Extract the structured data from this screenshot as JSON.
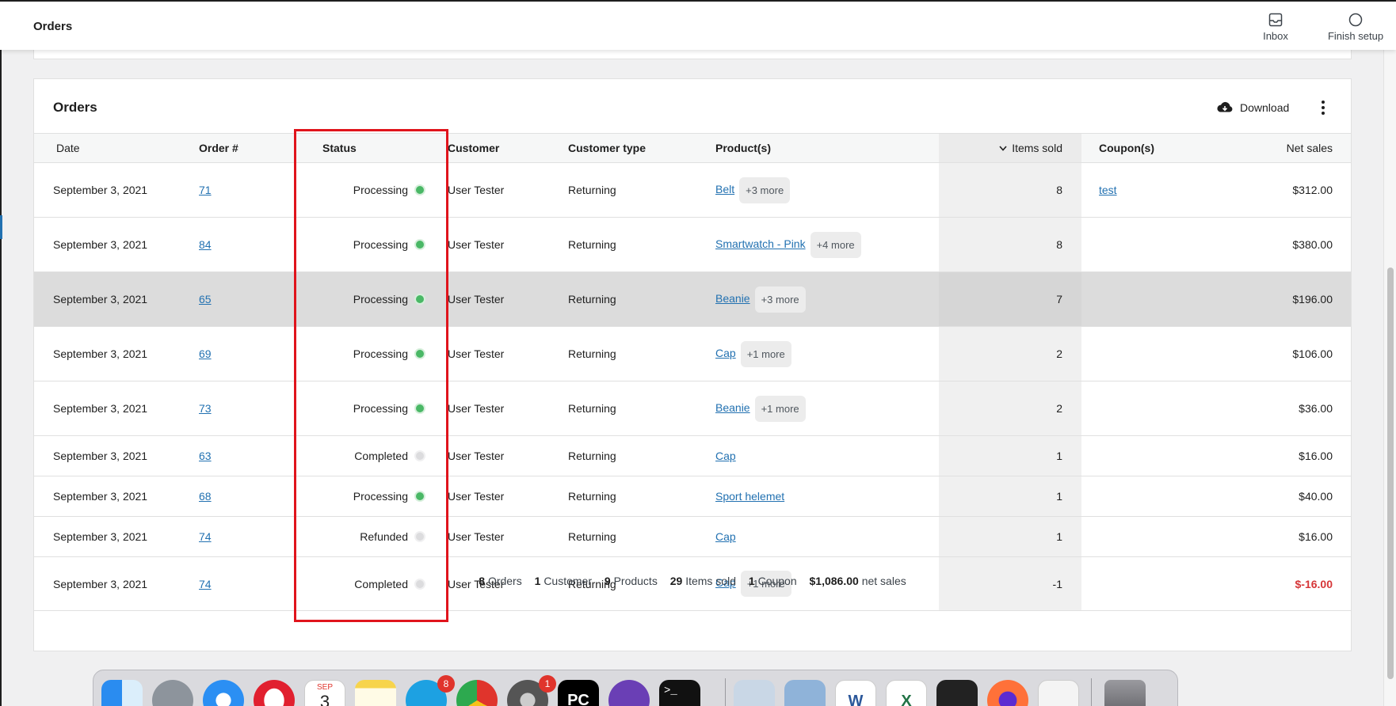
{
  "topbar": {
    "title": "Orders",
    "inbox_label": "Inbox",
    "finish_setup_label": "Finish setup"
  },
  "card": {
    "title": "Orders",
    "download_label": "Download"
  },
  "columns": {
    "date": "Date",
    "order": "Order #",
    "status": "Status",
    "customer": "Customer",
    "customer_type": "Customer type",
    "products": "Product(s)",
    "items_sold": "Items sold",
    "coupons": "Coupon(s)",
    "net_sales": "Net sales"
  },
  "rows": [
    {
      "date": "September 3, 2021",
      "order": "71",
      "status": "Processing",
      "customer": "User Tester",
      "customer_type": "Returning",
      "product": "Belt",
      "more": "+3 more",
      "items": "8",
      "coupon": "test",
      "net": "$312.00"
    },
    {
      "date": "September 3, 2021",
      "order": "84",
      "status": "Processing",
      "customer": "User Tester",
      "customer_type": "Returning",
      "product": "Smartwatch - Pink",
      "more": "+4 more",
      "items": "8",
      "coupon": "",
      "net": "$380.00"
    },
    {
      "date": "September 3, 2021",
      "order": "65",
      "status": "Processing",
      "customer": "User Tester",
      "customer_type": "Returning",
      "product": "Beanie",
      "more": "+3 more",
      "items": "7",
      "coupon": "",
      "net": "$196.00"
    },
    {
      "date": "September 3, 2021",
      "order": "69",
      "status": "Processing",
      "customer": "User Tester",
      "customer_type": "Returning",
      "product": "Cap",
      "more": "+1 more",
      "items": "2",
      "coupon": "",
      "net": "$106.00"
    },
    {
      "date": "September 3, 2021",
      "order": "73",
      "status": "Processing",
      "customer": "User Tester",
      "customer_type": "Returning",
      "product": "Beanie",
      "more": "+1 more",
      "items": "2",
      "coupon": "",
      "net": "$36.00"
    },
    {
      "date": "September 3, 2021",
      "order": "63",
      "status": "Completed",
      "customer": "User Tester",
      "customer_type": "Returning",
      "product": "Cap",
      "more": "",
      "items": "1",
      "coupon": "",
      "net": "$16.00"
    },
    {
      "date": "September 3, 2021",
      "order": "68",
      "status": "Processing",
      "customer": "User Tester",
      "customer_type": "Returning",
      "product": "Sport helemet",
      "more": "",
      "items": "1",
      "coupon": "",
      "net": "$40.00"
    },
    {
      "date": "September 3, 2021",
      "order": "74",
      "status": "Refunded",
      "customer": "User Tester",
      "customer_type": "Returning",
      "product": "Cap",
      "more": "",
      "items": "1",
      "coupon": "",
      "net": "$16.00"
    },
    {
      "date": "September 3, 2021",
      "order": "74",
      "status": "Completed",
      "customer": "User Tester",
      "customer_type": "Returning",
      "product": "Cap",
      "more": "+1 more",
      "items": "-1",
      "coupon": "",
      "net": "$-16.00"
    }
  ],
  "summary": {
    "orders_count": "8",
    "orders_label": "Orders",
    "customers_count": "1",
    "customers_label": "Customer",
    "products_count": "9",
    "products_label": "Products",
    "items_count": "29",
    "items_label": "Items sold",
    "coupons_count": "1",
    "coupons_label": "Coupon",
    "net_value": "$1,086.00",
    "net_label": "net sales"
  },
  "dock": {
    "calendar_month": "SEP",
    "calendar_day": "3",
    "skype_badge": "8",
    "settings_badge": "1",
    "pycharm_label": "PC",
    "word_label": "W",
    "excel_label": "X",
    "terminal_label": ">_"
  },
  "colors": {
    "link": "#2271b1",
    "processing": "#4ab866",
    "negative": "#d63638",
    "highlight_box": "#e0141c"
  }
}
